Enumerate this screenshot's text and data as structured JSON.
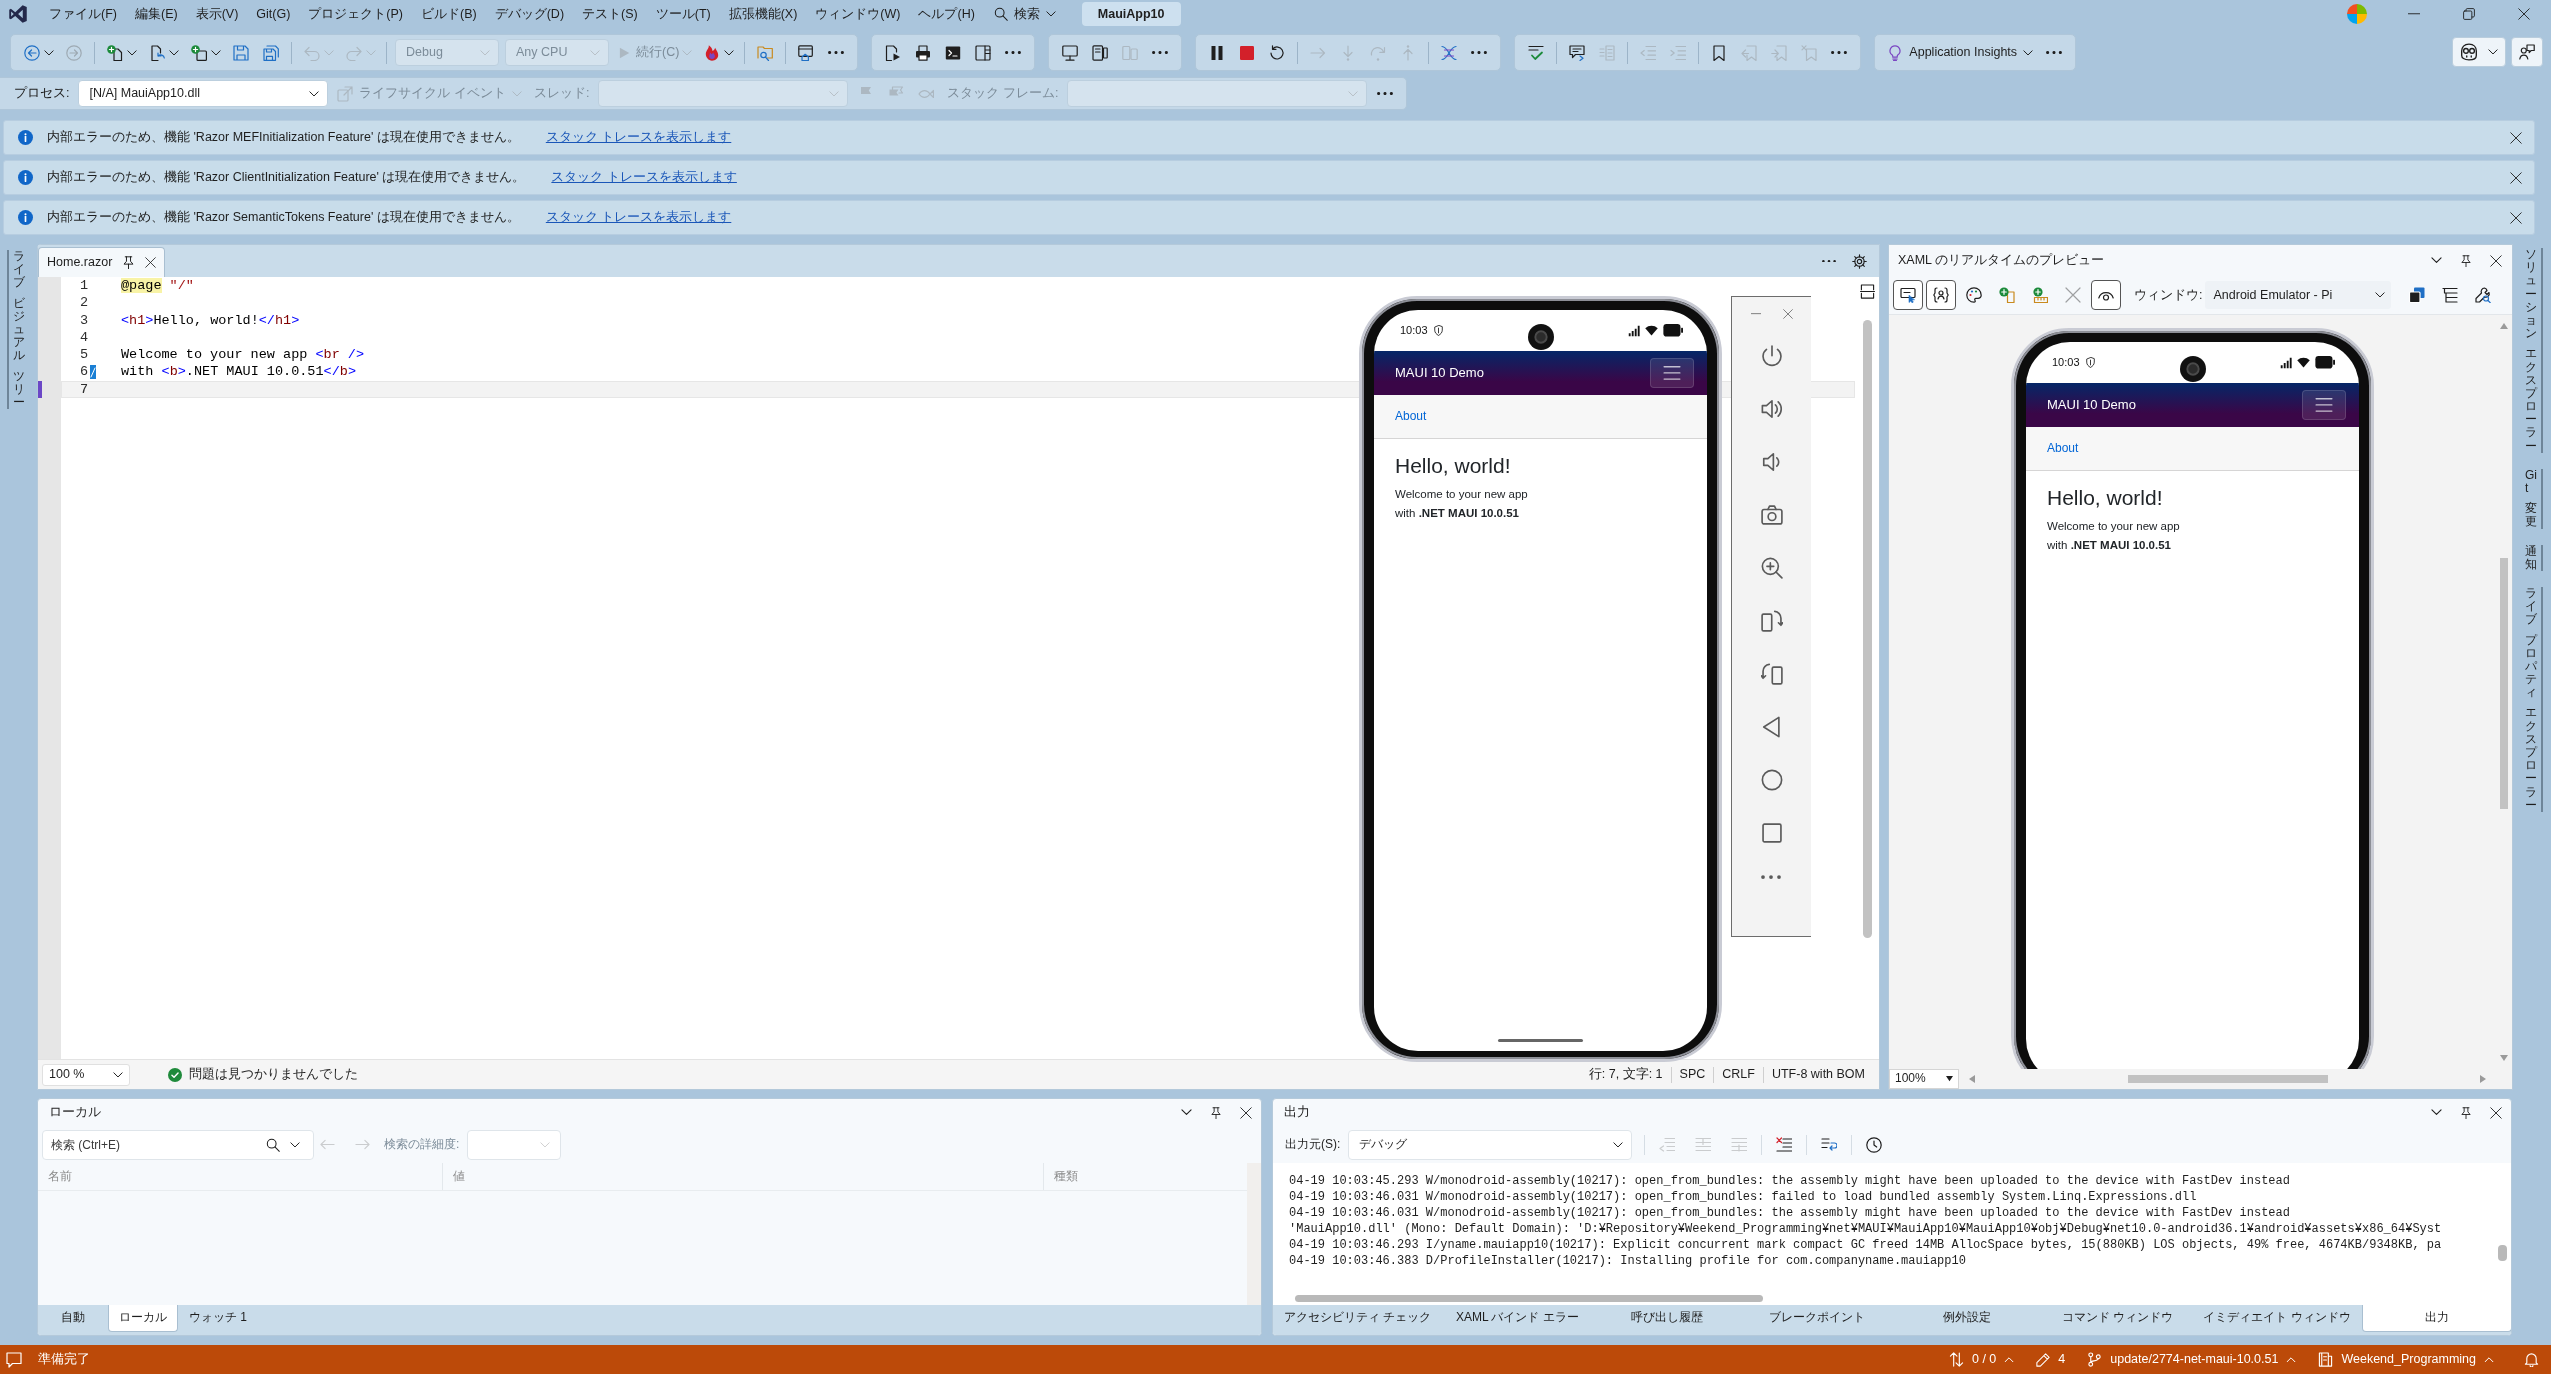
{
  "menu_bar": {
    "items": [
      "ファイル(F)",
      "編集(E)",
      "表示(V)",
      "Git(G)",
      "プロジェクト(P)",
      "ビルド(B)",
      "デバッグ(D)",
      "テスト(S)",
      "ツール(T)",
      "拡張機能(X)",
      "ウィンドウ(W)",
      "ヘルプ(H)"
    ],
    "search": "検索",
    "solution_name": "MauiApp10"
  },
  "toolbar": {
    "groups": [
      [
        [
          {
            "kind": "back",
            "disabled": false
          },
          {
            "kind": "caret",
            "disabled": false
          },
          {
            "kind": "forward",
            "disabled": true
          }
        ],
        [
          {
            "kind": "newproject",
            "disabled": false
          },
          {
            "kind": "caret",
            "disabled": false
          },
          {
            "kind": "open",
            "disabled": false
          },
          {
            "kind": "caret",
            "disabled": false
          },
          {
            "kind": "additem",
            "disabled": false
          },
          {
            "kind": "caret",
            "disabled": false
          },
          {
            "kind": "save",
            "disabled": false
          },
          {
            "kind": "saveall",
            "disabled": false
          }
        ],
        [
          {
            "kind": "undo",
            "disabled": true
          },
          {
            "kind": "caret",
            "disabled": true
          },
          {
            "kind": "redo",
            "disabled": true
          },
          {
            "kind": "caret",
            "disabled": true
          }
        ],
        [
          {
            "kind": "combo",
            "value": "Debug",
            "disabled": true
          },
          {
            "kind": "combo",
            "value": "Any CPU",
            "disabled": true
          },
          {
            "kind": "run",
            "label": "続行(C)",
            "disabled": true
          },
          {
            "kind": "caret",
            "disabled": true
          },
          {
            "kind": "hotreload",
            "disabled": false
          },
          {
            "kind": "caret",
            "disabled": false
          }
        ],
        [
          {
            "kind": "findfolder",
            "disabled": false
          }
        ],
        [
          {
            "kind": "browser",
            "disabled": false
          },
          {
            "kind": "more",
            "disabled": false
          }
        ]
      ],
      [
        [
          {
            "kind": "deploy",
            "disabled": false
          },
          {
            "kind": "printer",
            "disabled": false
          },
          {
            "kind": "terminal",
            "disabled": false
          },
          {
            "kind": "layout",
            "disabled": false
          },
          {
            "kind": "more",
            "disabled": false
          }
        ]
      ],
      [
        [
          {
            "kind": "monitor",
            "disabled": false
          },
          {
            "kind": "device",
            "disabled": false
          },
          {
            "kind": "devices",
            "disabled": true
          },
          {
            "kind": "more",
            "disabled": false
          }
        ]
      ],
      [
        [
          {
            "kind": "pause",
            "disabled": false
          },
          {
            "kind": "stop",
            "disabled": false
          },
          {
            "kind": "restart",
            "disabled": false
          }
        ],
        [
          {
            "kind": "stepover",
            "disabled": true
          },
          {
            "kind": "stepinto",
            "disabled": true
          },
          {
            "kind": "stepout",
            "disabled": true
          },
          {
            "kind": "stepup",
            "disabled": true
          }
        ],
        [
          {
            "kind": "helix",
            "disabled": false
          },
          {
            "kind": "more",
            "disabled": false
          }
        ]
      ],
      [
        [
          {
            "kind": "spell",
            "disabled": false
          }
        ],
        [
          {
            "kind": "comment",
            "disabled": false
          },
          {
            "kind": "commentlines",
            "disabled": true
          }
        ],
        [
          {
            "kind": "outdent",
            "disabled": true
          },
          {
            "kind": "indent",
            "disabled": true
          }
        ],
        [
          {
            "kind": "bookmark",
            "disabled": false
          },
          {
            "kind": "bookmarkprev",
            "disabled": true
          },
          {
            "kind": "bookmarknext",
            "disabled": true
          },
          {
            "kind": "bookmarkclear",
            "disabled": true
          },
          {
            "kind": "more",
            "disabled": false
          }
        ]
      ],
      [
        [
          {
            "kind": "insights",
            "label": "Application Insights",
            "disabled": false
          },
          {
            "kind": "more",
            "disabled": false
          }
        ]
      ]
    ]
  },
  "debug_location": {
    "groups": [
      [
        [
          {
            "kind": "label",
            "label": "プロセス:",
            "disabled": false
          },
          {
            "kind": "combo",
            "value": "[N/A] MauiApp10.dll",
            "disabled": false
          },
          {
            "kind": "lifecycle",
            "label": "ライフサイクル イベント",
            "disabled": true
          },
          {
            "kind": "label",
            "label": "スレッド:",
            "disabled": true
          },
          {
            "kind": "combo",
            "disabled": true
          },
          {
            "kind": "flag",
            "disabled": true
          },
          {
            "kind": "flagall",
            "disabled": true
          },
          {
            "kind": "thread",
            "disabled": true
          },
          {
            "kind": "label",
            "label": "スタック フレーム:",
            "disabled": true
          },
          {
            "kind": "combo",
            "disabled": true
          },
          {
            "kind": "more",
            "disabled": false
          }
        ]
      ]
    ]
  },
  "info_bars": [
    {
      "message": "内部エラーのため、機能 'Razor MEFInitialization Feature' は現在使用できません。",
      "link": "スタック トレースを表示します"
    },
    {
      "message": "内部エラーのため、機能 'Razor ClientInitialization Feature' は現在使用できません。",
      "link": "スタック トレースを表示します"
    },
    {
      "message": "内部エラーのため、機能 'Razor SemanticTokens Feature' は現在使用できません。",
      "link": "スタック トレースを表示します"
    }
  ],
  "left_tool_tabs": [
    {
      "words": [
        "ライブ",
        "ビジュアル",
        "ツリー"
      ]
    }
  ],
  "editor": {
    "tabs": [
      {
        "title": "Home.razor",
        "selected": true
      }
    ],
    "lines": [
      {
        "number": "1",
        "current": false,
        "modified": false,
        "tokens": [
          {
            "kind": "directive",
            "text": "@page"
          },
          {
            "kind": "string",
            "text": " \"/\""
          }
        ]
      },
      {
        "number": "2",
        "current": false,
        "modified": false
      },
      {
        "number": "3",
        "current": false,
        "modified": false,
        "tokens": [
          {
            "kind": "punct",
            "text": "<"
          },
          {
            "kind": "tag",
            "text": "h1"
          },
          {
            "kind": "punct",
            "text": ">"
          },
          {
            "kind": "text",
            "text": "Hello, world!"
          },
          {
            "kind": "punct",
            "text": "</"
          },
          {
            "kind": "tag",
            "text": "h1"
          },
          {
            "kind": "punct",
            "text": ">"
          }
        ]
      },
      {
        "number": "4",
        "current": false,
        "modified": false
      },
      {
        "number": "5",
        "current": false,
        "modified": false,
        "tokens": [
          {
            "kind": "text",
            "text": "Welcome to your new app "
          },
          {
            "kind": "punct",
            "text": "<"
          },
          {
            "kind": "tag",
            "text": "br"
          },
          {
            "kind": "punct",
            "text": " />"
          }
        ]
      },
      {
        "number": "6",
        "current": false,
        "modified": true,
        "tokens": [
          {
            "kind": "text",
            "text": "with "
          },
          {
            "kind": "punct",
            "text": "<"
          },
          {
            "kind": "tag",
            "text": "b"
          },
          {
            "kind": "punct",
            "text": ">"
          },
          {
            "kind": "text",
            "text": ".NET MAUI 10.0.51"
          },
          {
            "kind": "punct",
            "text": "</"
          },
          {
            "kind": "tag",
            "text": "b"
          },
          {
            "kind": "punct",
            "text": ">"
          }
        ]
      },
      {
        "number": "7",
        "current": true,
        "modified": false
      }
    ],
    "zoom": "100 %",
    "issues": "問題は見つかりませんでした",
    "position": "行: 7, 文字: 1",
    "whitespace": "SPC",
    "line_ending": "CRLF",
    "encoding": "UTF-8 with BOM"
  },
  "emulator": {
    "phone": {
      "time": "10:03",
      "app_title": "MAUI 10 Demo",
      "nav_link": "About",
      "heading": "Hello, world!",
      "body": [
        "Welcome to your new app",
        "with **.NET MAUI 10.0.51**"
      ]
    }
  },
  "xaml_preview": {
    "title": "XAML のリアルタイムのプレビュー",
    "tools_left": [
      {
        "kind": "select",
        "on": true,
        "disabled": false
      },
      {
        "kind": "adorners",
        "on": true,
        "disabled": false
      },
      {
        "kind": "palette",
        "on": false,
        "disabled": false
      },
      {
        "kind": "addfile",
        "on": false,
        "disabled": false
      },
      {
        "kind": "addtray",
        "on": false,
        "disabled": false
      },
      {
        "kind": "clear",
        "on": false,
        "disabled": true
      },
      {
        "kind": "track",
        "on": true,
        "disabled": false
      }
    ],
    "window_label": "ウィンドウ:",
    "window_value": "Android Emulator - Pi",
    "tools_right": [
      {
        "kind": "windows",
        "on": false,
        "disabled": false
      },
      {
        "kind": "tree",
        "on": false,
        "disabled": false
      },
      {
        "kind": "inspect",
        "on": false,
        "disabled": false
      }
    ],
    "phone": {
      "time": "10:03",
      "app_title": "MAUI 10 Demo",
      "nav_link": "About",
      "heading": "Hello, world!",
      "body": [
        "Welcome to your new app",
        "with **.NET MAUI 10.0.51**"
      ]
    },
    "zoom": "100%"
  },
  "right_tool_tabs": [
    {
      "words": [
        "ソリューション",
        "エクスプローラー"
      ]
    },
    {
      "words": [
        "Git",
        "変更"
      ]
    },
    {
      "words": [
        "通知"
      ]
    },
    {
      "words": [
        "ライブ",
        "プロパティ",
        "エクスプローラー"
      ]
    }
  ],
  "locals": {
    "title": "ローカル",
    "search_placeholder": "検索 (Ctrl+E)",
    "nav": [
      {
        "kind": "arrowleft",
        "disabled": true
      },
      {
        "kind": "arrowright",
        "disabled": true
      }
    ],
    "depth": {
      "label": "検索の詳細度:",
      "disabled": true
    },
    "columns": [
      "名前",
      "値",
      "種類"
    ],
    "tabs": [
      {
        "label": "自動",
        "selected": false
      },
      {
        "label": "ローカル",
        "selected": true
      },
      {
        "label": "ウォッチ 1",
        "selected": false
      }
    ]
  },
  "output": {
    "title": "出力",
    "source_label": "出力元(S):",
    "source": "デバッグ",
    "tools": [
      [
        {
          "kind": "findprev",
          "disabled": true
        },
        {
          "kind": "prevmsg",
          "disabled": true
        },
        {
          "kind": "nextmsg",
          "disabled": true
        }
      ],
      [
        {
          "kind": "clearall",
          "disabled": false
        }
      ],
      [
        {
          "kind": "wordwrap",
          "disabled": false
        }
      ],
      [
        {
          "kind": "clock",
          "disabled": false
        }
      ]
    ],
    "lines": [
      "04-19 10:03:45.293 W/monodroid-assembly(10217): open_from_bundles: the assembly might have been uploaded to the device with FastDev instead",
      "04-19 10:03:46.031 W/monodroid-assembly(10217): open_from_bundles: failed to load bundled assembly System.Linq.Expressions.dll",
      "04-19 10:03:46.031 W/monodroid-assembly(10217): open_from_bundles: the assembly might have been uploaded to the device with FastDev instead",
      "'MauiApp10.dll' (Mono: Default Domain): 'D:¥Repository¥Weekend_Programming¥net¥MAUI¥MauiApp10¥MauiApp10¥obj¥Debug¥net10.0-android36.1¥android¥assets¥x86_64¥Syst",
      "04-19 10:03:46.293 I/yname.mauiapp10(10217): Explicit concurrent mark compact GC freed 14MB AllocSpace bytes, 15(880KB) LOS objects, 49% free, 4674KB/9348KB, pa",
      "04-19 10:03:46.383 D/ProfileInstaller(10217): Installing profile for com.companyname.mauiapp10"
    ],
    "tabs": [
      {
        "label": "アクセシビリティ チェック",
        "selected": false
      },
      {
        "label": "XAML バインド エラー",
        "selected": false
      },
      {
        "label": "呼び出し履歴",
        "selected": false
      },
      {
        "label": "ブレークポイント",
        "selected": false
      },
      {
        "label": "例外設定",
        "selected": false
      },
      {
        "label": "コマンド ウィンドウ",
        "selected": false
      },
      {
        "label": "イミディエイト ウィンドウ",
        "selected": false
      },
      {
        "label": "出力",
        "selected": true
      }
    ]
  },
  "status_bar": {
    "message": "準備完了",
    "changes": "0 / 0",
    "edits": "4",
    "branch": "update/2774-net-maui-10.0.51",
    "repository": "Weekend_Programming"
  }
}
